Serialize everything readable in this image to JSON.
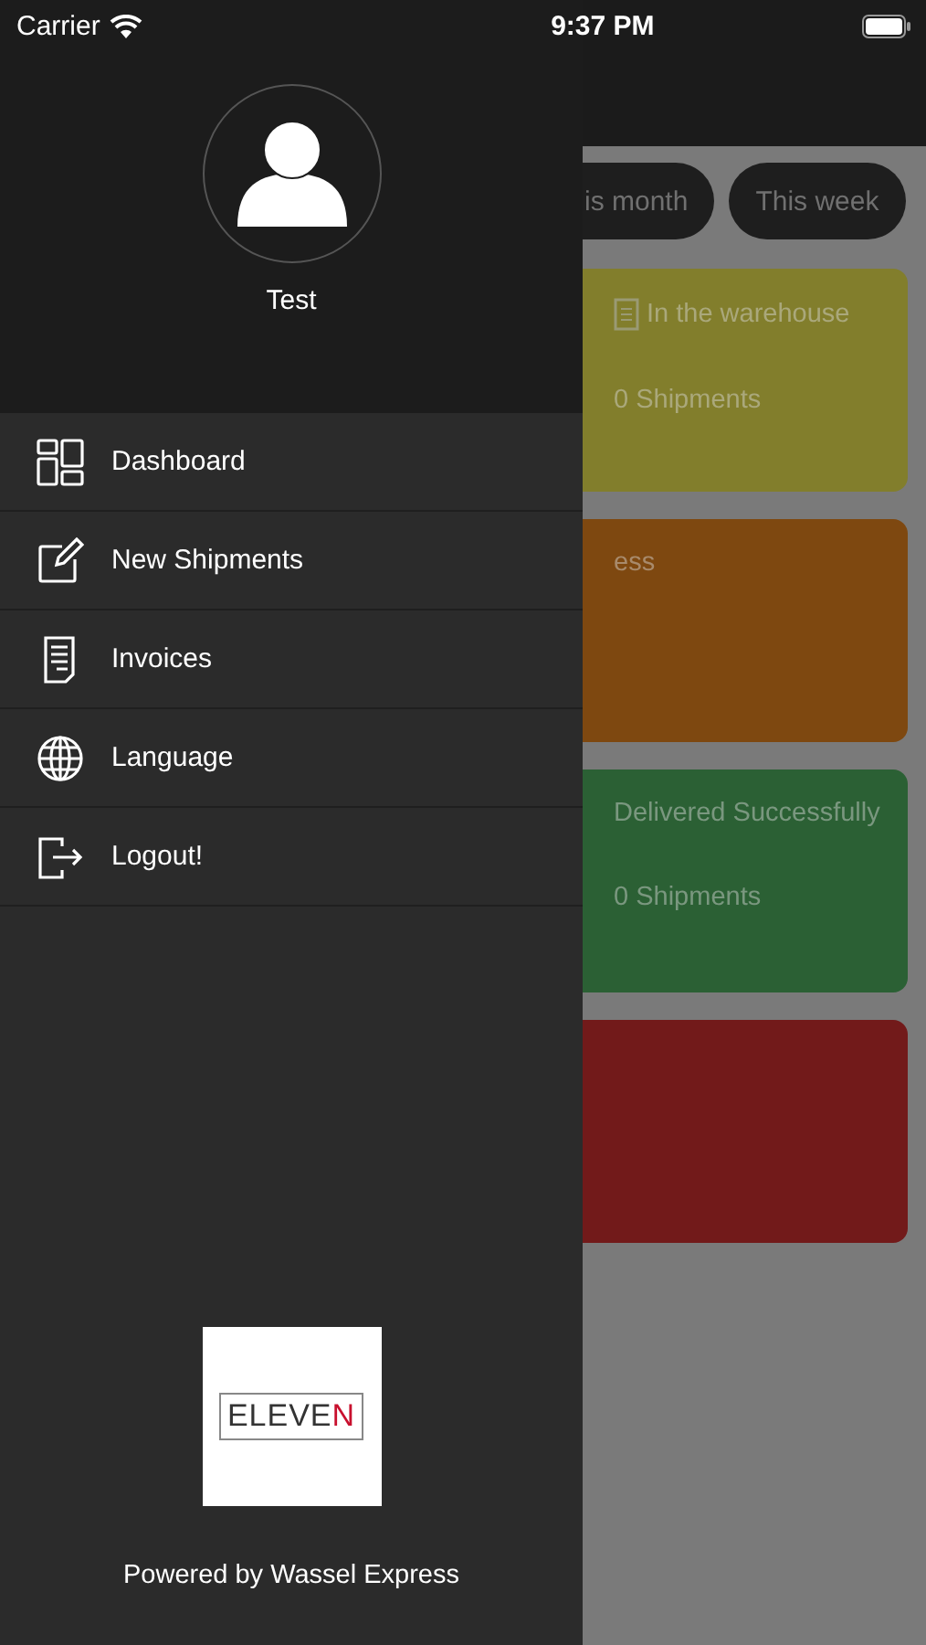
{
  "status_bar": {
    "carrier": "Carrier",
    "time": "9:37 PM"
  },
  "drawer": {
    "user": {
      "name": "Test"
    },
    "menu": [
      {
        "label": "Dashboard",
        "kind": "dashboard"
      },
      {
        "label": "New Shipments",
        "kind": "edit"
      },
      {
        "label": "Invoices",
        "kind": "invoice"
      },
      {
        "label": "Language",
        "kind": "globe"
      },
      {
        "label": "Logout!",
        "kind": "logout"
      }
    ],
    "logo": {
      "text": "ELEVE",
      "accent": "N"
    },
    "footer": "Powered by Wassel Express"
  },
  "background": {
    "filters": [
      {
        "label": "is month"
      },
      {
        "label": "This week"
      }
    ],
    "cards": [
      {
        "title": "In the warehouse",
        "count": "0 Shipments",
        "color": "#827e2c",
        "icon": true
      },
      {
        "title": "ess",
        "color": "#7e4810",
        "icon": false
      },
      {
        "title": "Delivered Successfully",
        "count": "0 Shipments",
        "color": "#2b6034",
        "icon": false
      },
      {
        "color": "#721a1a",
        "icon": false
      }
    ]
  }
}
